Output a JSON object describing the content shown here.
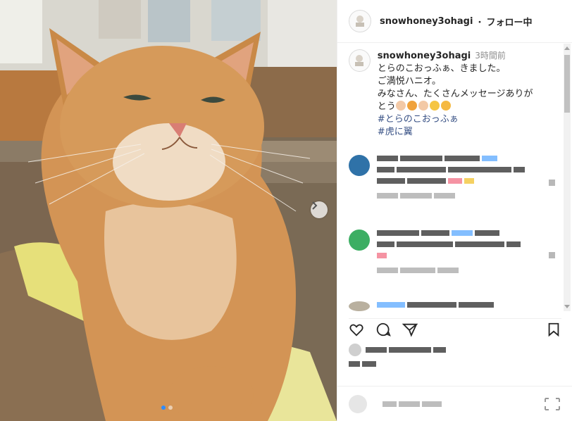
{
  "post": {
    "username": "snowhoney3ohagi",
    "separator": "・",
    "follow_status": "フォロー中",
    "time_ago": "3時間前",
    "caption_lines": [
      "とらのこおっふぁ、きました。",
      "ご満悦ハニオ。",
      "みなさん、たくさんメッセージありが",
      "とう"
    ],
    "hashtags": [
      "#とらのこおっふぁ",
      "#虎に翼"
    ]
  },
  "icons": {
    "next": "chevron-right-icon",
    "like": "heart-icon",
    "comment": "comment-icon",
    "share": "share-icon",
    "save": "bookmark-icon"
  },
  "colors": {
    "hashtag": "#385185",
    "carousel_active": "#2f8cff",
    "text": "#262626",
    "muted": "#8e8e8e"
  }
}
